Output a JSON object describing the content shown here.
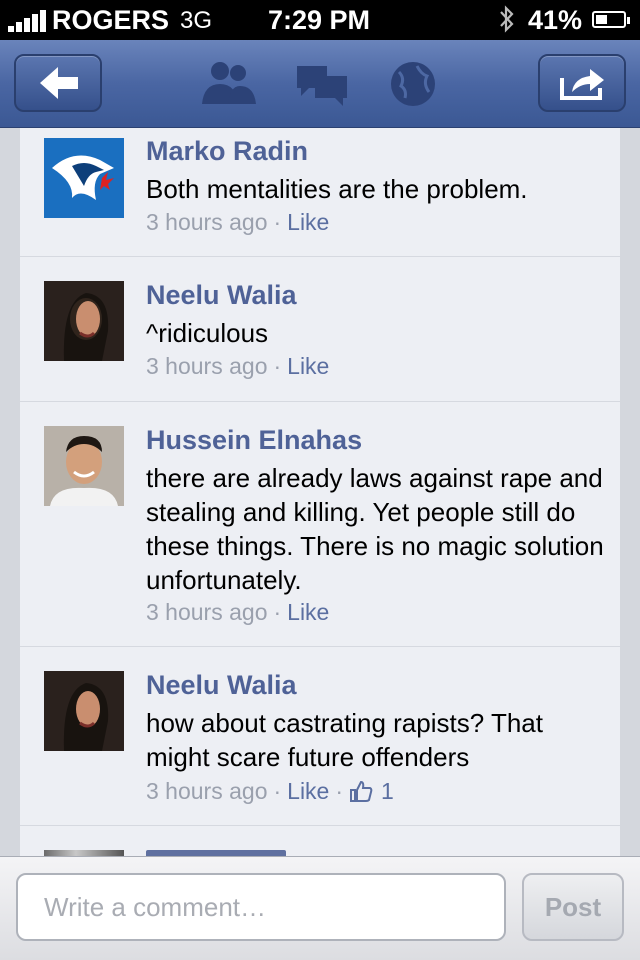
{
  "status_bar": {
    "carrier": "ROGERS",
    "network": "3G",
    "time": "7:29 PM",
    "battery_percent": "41%",
    "battery_level": 0.41
  },
  "nav": {
    "back_icon": "back-arrow-icon",
    "friends_icon": "friends-icon",
    "messages_icon": "messages-icon",
    "notifications_icon": "globe-icon",
    "share_icon": "share-icon"
  },
  "comments": [
    {
      "name": "Marko Radin",
      "text": "Both mentalities are the problem.",
      "time": "3 hours ago",
      "like": "Like"
    },
    {
      "name": "Neelu Walia",
      "text": "^ridiculous",
      "time": "3 hours ago",
      "like": "Like"
    },
    {
      "name": "Hussein Elnahas",
      "text": "there are already laws against rape and stealing and killing. Yet people still do these things. There is no magic solution unfortunately.",
      "time": "3 hours ago",
      "like": "Like"
    },
    {
      "name": "Neelu Walia",
      "text": "how about castrating rapists? That might scare future offenders",
      "time": "3 hours ago",
      "like": "Like",
      "like_count": "1"
    }
  ],
  "composer": {
    "placeholder": "Write a comment…",
    "post_label": "Post"
  },
  "colors": {
    "nav_blue": "#3b5894",
    "name_blue": "#4f6297",
    "list_bg": "#edeff4"
  }
}
